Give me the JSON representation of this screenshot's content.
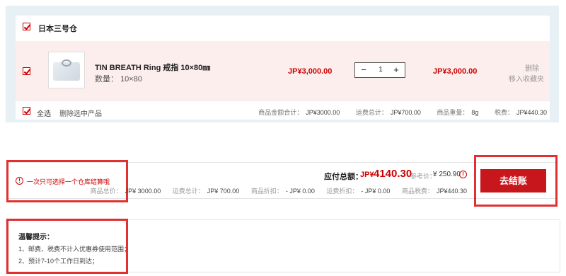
{
  "warehouse": {
    "name": "日本三号仓"
  },
  "item": {
    "name": "TIN BREATH Ring 戒指 10×80㎜",
    "qty_label": "数量：",
    "qty_spec": "10×80",
    "unit_price": "JP¥3,000.00",
    "quantity": "1",
    "subtotal": "JP¥3,000.00",
    "delete_label": "删除",
    "favorite_label": "移入收藏夹"
  },
  "cart_footer": {
    "select_all": "全选",
    "delete_selected": "删除选中产品",
    "stats": [
      {
        "label": "商品金额合计：",
        "value": "JP¥3000.00"
      },
      {
        "label": "运费总计：",
        "value": "JP¥700.00"
      },
      {
        "label": "商品重量：",
        "value": "8g"
      },
      {
        "label": "税费：",
        "value": "JP¥440.30"
      }
    ]
  },
  "notice": "一次只可选择一个仓库结算哦",
  "order": {
    "total_label": "应付总额：",
    "total_currency": "JP¥",
    "total_value": "4140.30",
    "ref_label": "参考价：",
    "ref_value": "¥ 250.90",
    "breakdown": [
      {
        "label": "商品总价：",
        "value": "JP¥ 3000.00"
      },
      {
        "label": "运费总计：",
        "value": "JP¥ 700.00"
      },
      {
        "label": "商品折扣：",
        "value": "- JP¥ 0.00"
      },
      {
        "label": "运费折扣：",
        "value": "- JP¥ 0.00"
      },
      {
        "label": "商品税费：",
        "value": "JP¥440.30"
      }
    ],
    "checkout_label": "去结账"
  },
  "tips": {
    "title": "温馨提示：",
    "lines": [
      "1、邮费、税费不计入优惠券使用范围；",
      "2、预计7-10个工作日到达；"
    ]
  },
  "colors": {
    "accent": "#c8161d",
    "highlight_row": "#fdeeee",
    "frame": "#e0302f"
  }
}
